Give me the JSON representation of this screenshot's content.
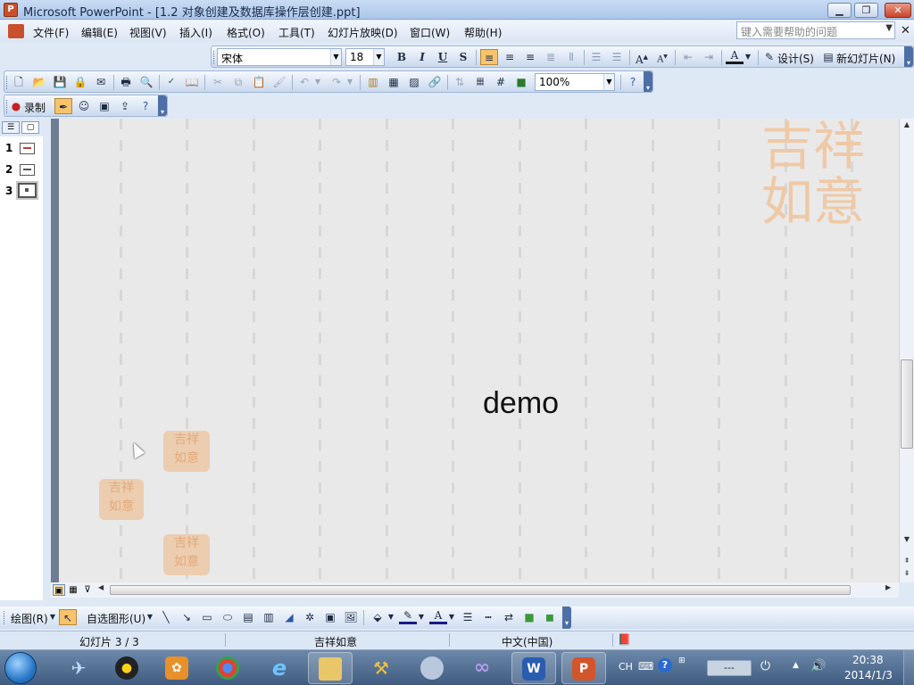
{
  "window": {
    "title": "Microsoft PowerPoint - [1.2  对象创建及数据库操作层创建.ppt]",
    "app_icon": "powerpoint-icon"
  },
  "menu": {
    "items": [
      "文件(F)",
      "编辑(E)",
      "视图(V)",
      "插入(I)",
      "格式(O)",
      "工具(T)",
      "幻灯片放映(D)",
      "窗口(W)",
      "帮助(H)"
    ],
    "help_placeholder": "键入需要帮助的问题"
  },
  "format_toolbar": {
    "font": "宋体",
    "font_size": "18",
    "bold": "B",
    "italic": "I",
    "underline": "U",
    "shadow": "S",
    "design_label": "设计(S)",
    "new_slide_label": "新幻灯片(N)"
  },
  "standard_toolbar": {
    "zoom": "100%"
  },
  "review_toolbar": {
    "record_label": "录制"
  },
  "slides_pane": {
    "slides": [
      {
        "number": "1"
      },
      {
        "number": "2"
      },
      {
        "number": "3"
      }
    ],
    "selected": "3"
  },
  "slide": {
    "text": "demo"
  },
  "drawing_toolbar": {
    "draw_label": "绘图(R)",
    "autoshapes_label": "自选图形(U)"
  },
  "status": {
    "slide_position": "幻灯片 3 / 3",
    "design_template": "吉祥如意",
    "language": "中文(中国)"
  },
  "taskbar": {
    "input_language": "CH",
    "clock_time": "20:38",
    "clock_date": "2014/1/3",
    "tray_box": "---"
  },
  "colors": {
    "accent_active": "#f7c36c",
    "seal": "#eccdb0",
    "slide_bg": "#e9e9e9"
  }
}
